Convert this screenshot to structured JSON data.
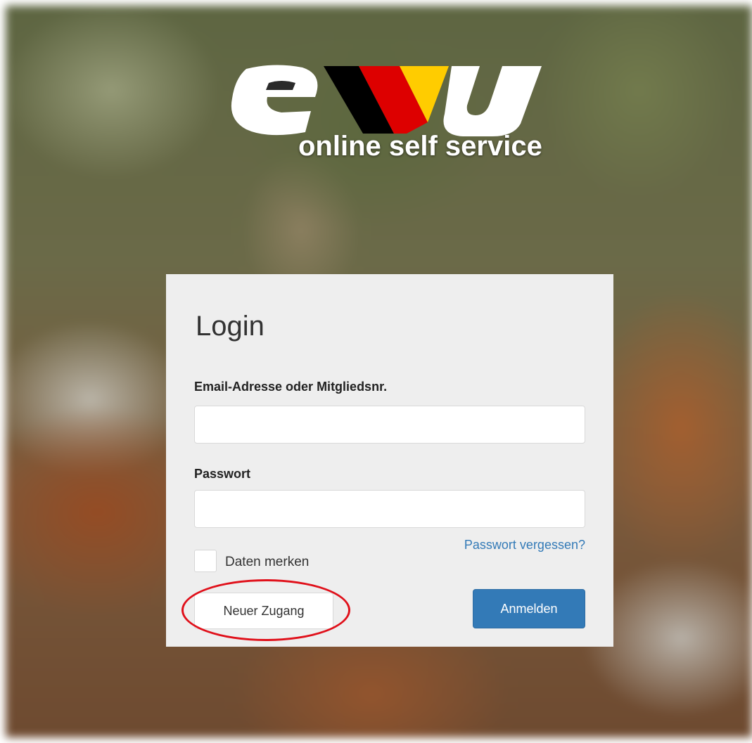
{
  "brand": {
    "logo_text": "ewu",
    "subtitle": "online self service",
    "colors": {
      "black": "#000000",
      "red": "#dd0000",
      "gold": "#ffcc00"
    }
  },
  "form": {
    "title": "Login",
    "email_label": "Email-Adresse oder Mitgliedsnr.",
    "email_value": "",
    "password_label": "Passwort",
    "password_value": "",
    "forgot_link": "Passwort vergessen?",
    "remember_label": "Daten merken",
    "remember_checked": false,
    "new_account_button": "Neuer Zugang",
    "login_button": "Anmelden"
  },
  "colors": {
    "panel": "#eeeeee",
    "primary": "#337ab7",
    "annotation": "#e0101a"
  }
}
